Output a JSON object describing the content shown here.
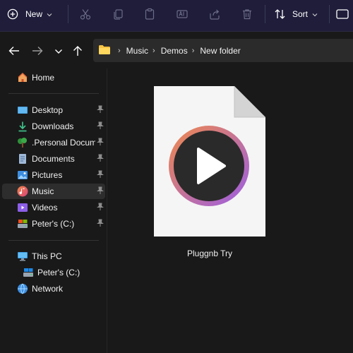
{
  "toolbar": {
    "new_label": "New",
    "sort_label": "Sort",
    "icons": [
      "plus-circle-icon",
      "cut-icon",
      "copy-icon",
      "paste-icon",
      "rename-icon",
      "share-icon",
      "delete-icon",
      "sort-icon",
      "view-icon"
    ]
  },
  "address": {
    "crumbs": [
      "Music",
      "Demos",
      "New folder"
    ]
  },
  "sidebar": {
    "home": "Home",
    "quick_access": [
      {
        "label": "Desktop",
        "icon": "desktop-icon",
        "pinned": true
      },
      {
        "label": "Downloads",
        "icon": "download-icon",
        "pinned": true
      },
      {
        "label": ".Personal Documents",
        "icon": "tree-folder-icon",
        "pinned": true
      },
      {
        "label": "Documents",
        "icon": "documents-icon",
        "pinned": true
      },
      {
        "label": "Pictures",
        "icon": "pictures-icon",
        "pinned": true
      },
      {
        "label": "Music",
        "icon": "music-icon",
        "pinned": true,
        "selected": true
      },
      {
        "label": "Videos",
        "icon": "videos-icon",
        "pinned": true
      },
      {
        "label": "Peter's (C:)",
        "icon": "drive-icon",
        "pinned": true
      }
    ],
    "this_pc": "This PC",
    "this_pc_drive": "Peter's (C:)",
    "network": "Network"
  },
  "content": {
    "file_name": "Pluggnb Try",
    "file_icon": "media-play-file-icon"
  },
  "colors": {
    "toolbar_bg": "#1f1d3a",
    "window_bg": "#191919",
    "selected_bg": "#2d2d2d",
    "play_ring_start": "#f0894a",
    "play_ring_end": "#9b5de5"
  }
}
